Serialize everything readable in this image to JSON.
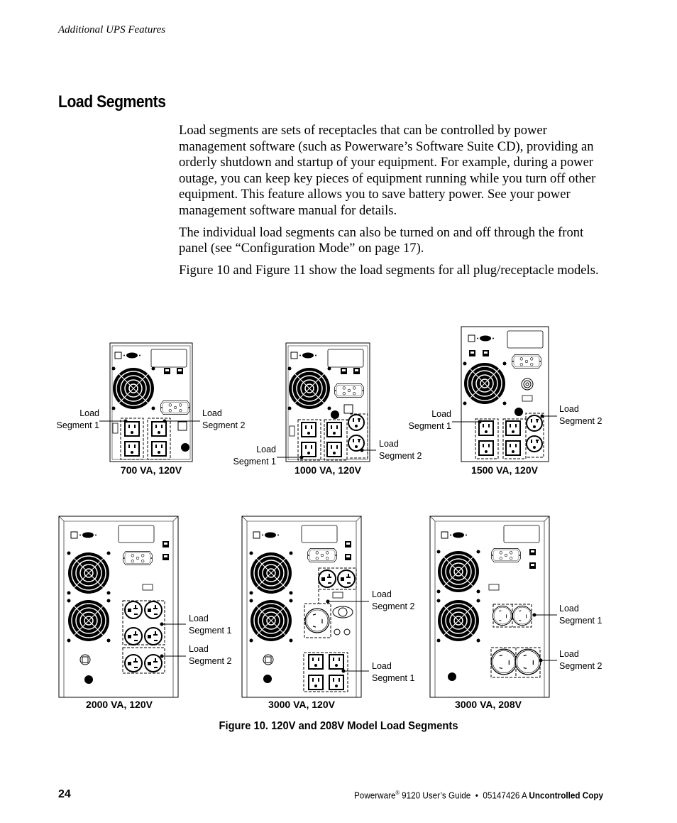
{
  "header": {
    "running_head": "Additional UPS Features"
  },
  "section": {
    "title": "Load Segments",
    "paragraphs": [
      "Load segments are sets of receptacles that can be controlled by power management software (such as Powerware’s Software Suite CD), providing an orderly shutdown and startup of your equipment. For example, during a power outage, you can keep key pieces of equipment running while you turn off other equipment. This feature allows you to save battery power. See your power management software manual for details.",
      "The individual load segments can also be turned on and off through the front panel (see “Configuration Mode” on page 17).",
      "Figure 10 and Figure 11 show the load segments for all plug/receptacle models."
    ]
  },
  "figure": {
    "caption": "Figure 10. 120V and 208V Model Load Segments",
    "label_word": "Load",
    "seg1": "Segment 1",
    "seg2": "Segment 2",
    "models": [
      {
        "name": "700 VA, 120V"
      },
      {
        "name": "1000 VA, 120V"
      },
      {
        "name": "1500 VA, 120V"
      },
      {
        "name": "2000 VA, 120V"
      },
      {
        "name": "3000 VA, 120V"
      },
      {
        "name": "3000 VA, 208V"
      }
    ]
  },
  "footer": {
    "page_number": "24",
    "brand": "Powerware",
    "reg": "®",
    "guide": " 9120 User’s Guide  •  05147426 A ",
    "copy": "Uncontrolled Copy"
  }
}
